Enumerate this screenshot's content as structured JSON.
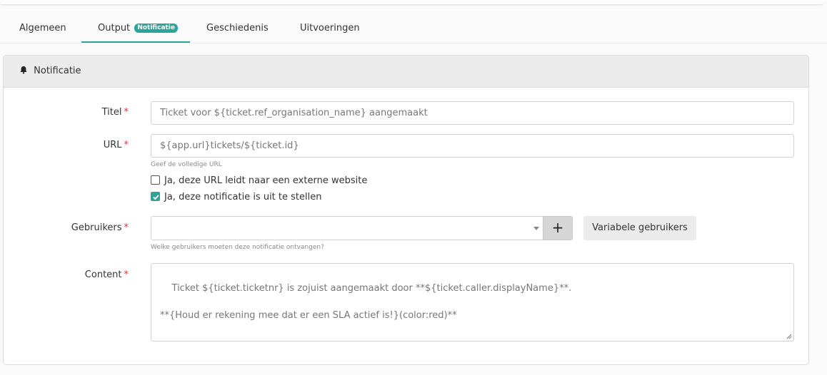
{
  "tabs": [
    {
      "label": "Algemeen",
      "active": false
    },
    {
      "label": "Output",
      "badge": "Notificatie",
      "active": true
    },
    {
      "label": "Geschiedenis",
      "active": false
    },
    {
      "label": "Uitvoeringen",
      "active": false
    }
  ],
  "panel": {
    "icon": "bell-icon",
    "title": "Notificatie"
  },
  "form": {
    "required_marker": "*",
    "titel": {
      "label": "Titel",
      "value": "Ticket voor ${ticket.ref_organisation_name} aangemaakt"
    },
    "url": {
      "label": "URL",
      "value": "${app.url}tickets/${ticket.id}",
      "help": "Geef de volledige URL",
      "external_checkbox": {
        "label": "Ja, deze URL leidt naar een externe website",
        "checked": false
      },
      "postpone_checkbox": {
        "label": "Ja, deze notificatie is uit te stellen",
        "checked": true
      }
    },
    "gebruikers": {
      "label": "Gebruikers",
      "value": "",
      "add_button": "+",
      "variable_button": "Variabele gebruikers",
      "help": "Welke gebruikers moeten deze notificatie ontvangen?"
    },
    "content": {
      "label": "Content",
      "value": "Ticket ${ticket.ticketnr} is zojuist aangemaakt door **${ticket.caller.displayName}**.\n\n**{Houd er rekening mee dat er een SLA actief is!}(color:red)**"
    }
  },
  "colors": {
    "accent": "#2ea39a",
    "required": "#d9333f"
  }
}
